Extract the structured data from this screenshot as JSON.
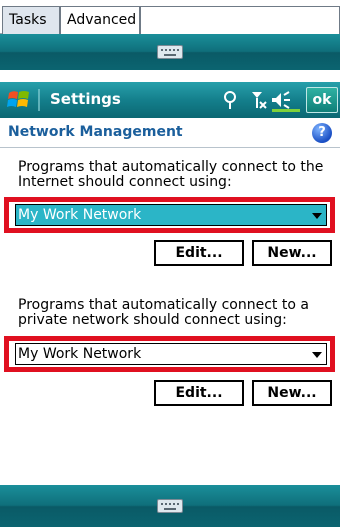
{
  "tabs": [
    {
      "label": "Tasks"
    },
    {
      "label": "Advanced"
    }
  ],
  "title_bar": {
    "title": "Settings",
    "ok_label": "ok",
    "icons": [
      "windows-start-icon",
      "connectivity-icon",
      "signal-off-icon",
      "volume-icon"
    ]
  },
  "page": {
    "section_title": "Network Management",
    "help_label": "?",
    "internet": {
      "label": "Programs that automatically connect to the Internet should connect using:",
      "selected": "My Work Network",
      "edit_label": "Edit...",
      "new_label": "New..."
    },
    "private": {
      "label": "Programs that automatically connect to a private network should connect using:",
      "selected": "My Work Network",
      "edit_label": "Edit...",
      "new_label": "New..."
    }
  },
  "colors": {
    "title_bar": "#147f8c",
    "selected_dropdown": "#2bb5c7",
    "highlight_border": "#e01020",
    "section_title": "#1b5f9c"
  }
}
